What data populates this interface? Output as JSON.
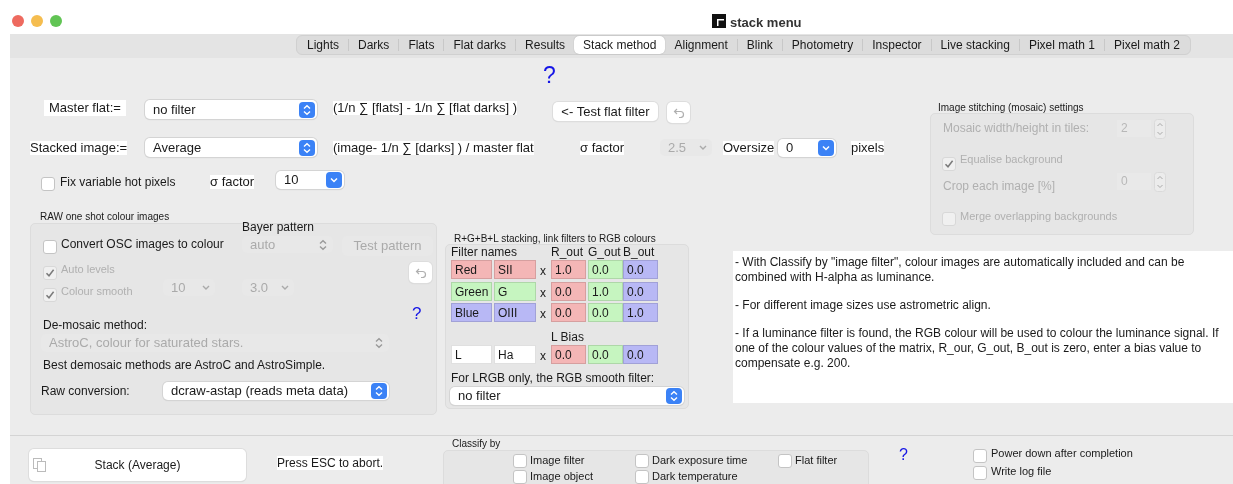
{
  "window": {
    "title": "stack menu"
  },
  "tabs": [
    {
      "label": "Lights",
      "selected": false
    },
    {
      "label": "Darks",
      "selected": false
    },
    {
      "label": "Flats",
      "selected": false
    },
    {
      "label": "Flat darks",
      "selected": false
    },
    {
      "label": "Results",
      "selected": false
    },
    {
      "label": "Stack method",
      "selected": true
    },
    {
      "label": "Alignment",
      "selected": false
    },
    {
      "label": "Blink",
      "selected": false
    },
    {
      "label": "Photometry",
      "selected": false
    },
    {
      "label": "Inspector",
      "selected": false
    },
    {
      "label": "Live stacking",
      "selected": false
    },
    {
      "label": "Pixel math 1",
      "selected": false
    },
    {
      "label": "Pixel math 2",
      "selected": false
    }
  ],
  "help_top": "?",
  "master_flat": {
    "label": "Master flat:=",
    "value": "no filter",
    "formula": "(1/n ∑ [flats] - 1/n ∑ [flat darks] )",
    "test_button": "<- Test flat filter"
  },
  "stacked_image": {
    "label": "Stacked image:=",
    "value": "Average",
    "formula": "(image- 1/n ∑ [darks] ) / master flat",
    "sigma_label": "σ factor",
    "sigma_value": "2.5",
    "sigma_disabled": true,
    "oversize_label": "Oversize",
    "oversize_value": "0",
    "pixels_label": "pixels"
  },
  "hot_pixels": {
    "label": "Fix variable hot pixels",
    "checked": false,
    "sigma_label": "σ factor",
    "sigma_value": "10"
  },
  "raw_osc": {
    "title": "RAW one shot colour images",
    "convert": {
      "label": "Convert OSC images to colour",
      "checked": false
    },
    "bayer_label": "Bayer pattern",
    "bayer_value": "auto",
    "test_button": "Test pattern",
    "auto_levels": {
      "label": "Auto levels",
      "checked": true,
      "disabled": true
    },
    "colour_smooth": {
      "label": "Colour smooth",
      "checked": true,
      "disabled": true,
      "value_1": "10",
      "value_2": "3.0"
    },
    "help": "?",
    "demosaic_label": "De-mosaic method:",
    "demosaic_value": "AstroC, colour for saturated stars.",
    "demosaic_note": "Best demosaic methods are AstroC and AstroSimple.",
    "raw_label": "Raw conversion:",
    "raw_value": "dcraw-astap (reads meta data)"
  },
  "rgb_stacking": {
    "title": "R+G+B+L stacking, link filters to RGB colours",
    "filter_names_label": "Filter names",
    "columns": [
      {
        "label": "R_out",
        "color": "#f4b6b6"
      },
      {
        "label": "G_out",
        "color": "#c6f5c0"
      },
      {
        "label": "B_out",
        "color": "#b8b8f5"
      }
    ],
    "rows": [
      {
        "names": [
          "Red",
          "SII"
        ],
        "color": "#f4b6b6",
        "times": "x",
        "values": [
          "1.0",
          "0.0",
          "0.0"
        ]
      },
      {
        "names": [
          "Green",
          "G"
        ],
        "color": "#c6f5c0",
        "times": "x",
        "values": [
          "0.0",
          "1.0",
          "0.0"
        ]
      },
      {
        "names": [
          "Blue",
          "OIII"
        ],
        "color": "#b8b8f5",
        "times": "x",
        "values": [
          "0.0",
          "0.0",
          "1.0"
        ]
      }
    ],
    "bias_label": "L Bias",
    "luminance_row": {
      "names": [
        "L",
        "Ha"
      ],
      "times": "x",
      "values": [
        "0.0",
        "0.0",
        "0.0"
      ]
    },
    "smooth_label": "For LRGB only, the RGB smooth filter:",
    "smooth_value": "no filter"
  },
  "notes": [
    "- With Classify by \"image filter\", colour images are automatically included and can be combined with H-alpha as luminance.",
    "- For different image sizes use astrometric align.",
    "- If a luminance filter is found, the RGB colour will be used to colour the luminance signal. If one of the colour values of the matrix, R_our, G_out, B_out is zero, enter a bias value to compensate e.g. 200."
  ],
  "mosaic": {
    "title": "Image stitching (mosaic) settings",
    "disabled": true,
    "width_label": "Mosaic width/height  in tiles:",
    "width_value": "2",
    "equalise": {
      "label": "Equalise background",
      "checked": true
    },
    "crop_label": "Crop each image [%]",
    "crop_value": "0",
    "merge": {
      "label": "Merge overlapping backgrounds",
      "checked": false
    }
  },
  "bottom": {
    "stack_button": "Stack (Average)",
    "esc_note": "Press ESC to abort.",
    "classify": {
      "title": "Classify by",
      "options": [
        {
          "label": "Image filter",
          "checked": false
        },
        {
          "label": "Image object",
          "checked": false
        },
        {
          "label": "Dark exposure time",
          "checked": false
        },
        {
          "label": "Dark temperature",
          "checked": false
        },
        {
          "label": "Flat filter",
          "checked": false
        }
      ]
    },
    "help": "?",
    "power_down": {
      "label": "Power down after completion",
      "checked": false
    },
    "write_log": {
      "label": "Write log file",
      "checked": false
    }
  }
}
